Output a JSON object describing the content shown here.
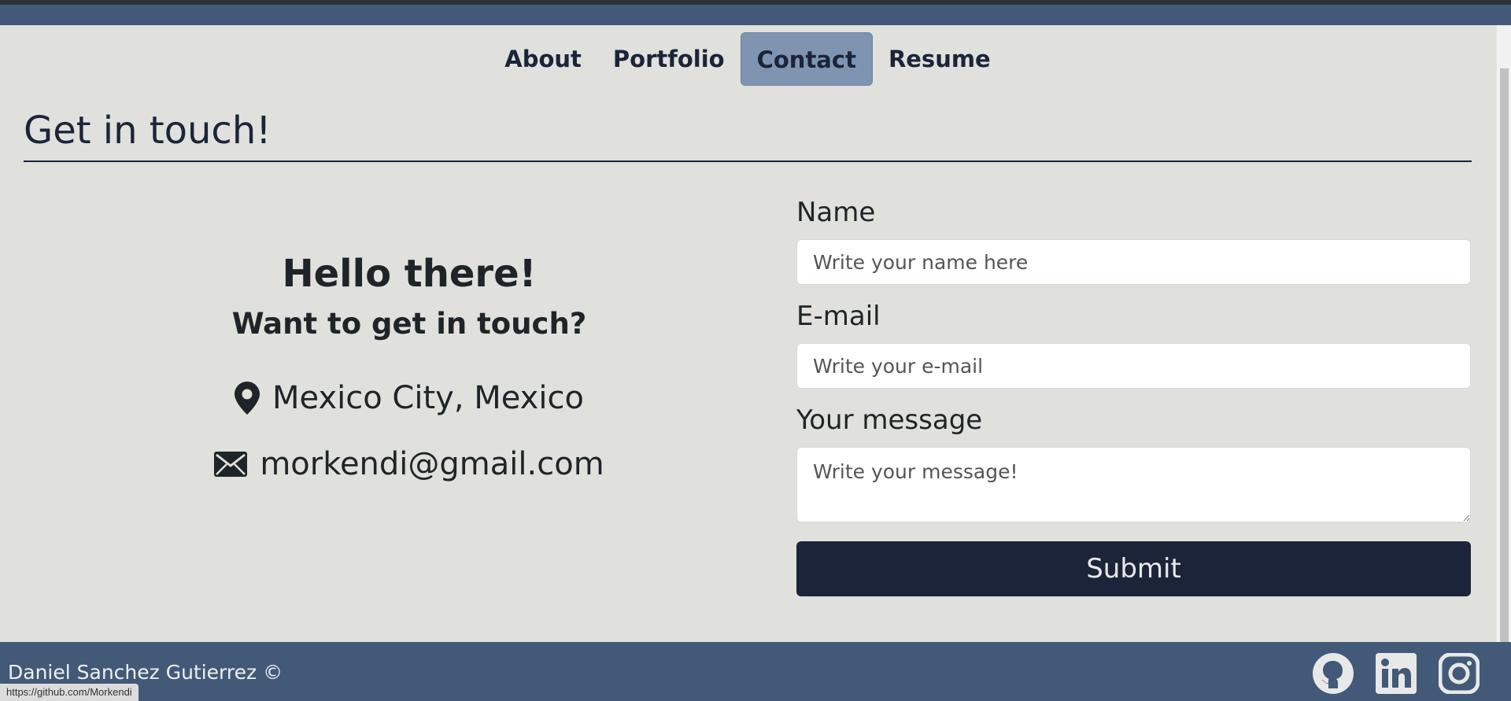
{
  "nav": {
    "items": [
      {
        "label": "About",
        "active": false
      },
      {
        "label": "Portfolio",
        "active": false
      },
      {
        "label": "Contact",
        "active": true
      },
      {
        "label": "Resume",
        "active": false
      }
    ]
  },
  "page": {
    "title": "Get in touch!"
  },
  "intro": {
    "hello": "Hello there!",
    "question": "Want to get in touch?",
    "location": "Mexico City, Mexico",
    "email": "morkendi@gmail.com",
    "location_icon": "map-pin-icon",
    "email_icon": "envelope-icon"
  },
  "form": {
    "name_label": "Name",
    "name_placeholder": "Write your name here",
    "email_label": "E-mail",
    "email_placeholder": "Write your e-mail",
    "message_label": "Your message",
    "message_placeholder": "Write your message!",
    "submit_label": "Submit"
  },
  "footer": {
    "copyright": "Daniel Sanchez Gutierrez ©",
    "social": [
      "github-icon",
      "linkedin-icon",
      "instagram-icon"
    ]
  },
  "status_bar": {
    "url": "https://github.com/Morkendi"
  },
  "colors": {
    "background": "#e0e0dc",
    "header_footer": "#425a78",
    "primary_dark": "#1b2439",
    "nav_active": "#7f94b0"
  }
}
